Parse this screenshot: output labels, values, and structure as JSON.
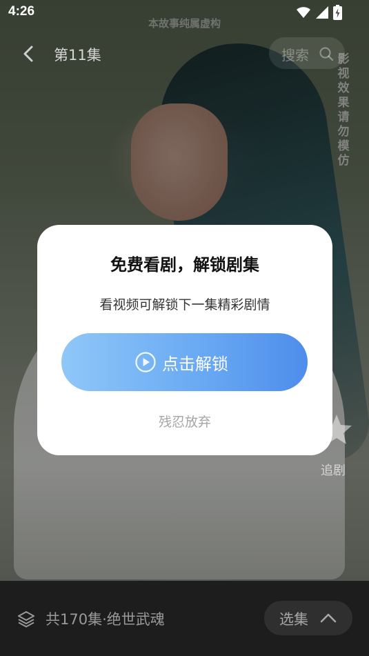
{
  "status_bar": {
    "time": "4:26",
    "icons": [
      "wifi-icon",
      "cellular-signal-icon",
      "battery-charging-icon"
    ]
  },
  "video": {
    "disclaimer": "本故事纯属虚构",
    "vertical_notice": "影视效果请勿模仿"
  },
  "top_bar": {
    "back_icon": "chevron-left-icon",
    "episode_title": "第11集",
    "search_placeholder": "搜索",
    "search_icon": "search-icon"
  },
  "side_actions": {
    "follow_label": "追剧",
    "follow_icon": "star-icon"
  },
  "bottom_bar": {
    "series_icon": "layers-icon",
    "series_info": "共170集·绝世武魂",
    "episodes_button": "选集",
    "episodes_icon": "chevron-up-icon"
  },
  "unlock_dialog": {
    "title": "免费看剧，解锁剧集",
    "subtitle": "看视频可解锁下一集精彩剧情",
    "unlock_button": "点击解锁",
    "unlock_icon": "play-circle-icon",
    "dismiss": "残忍放弃"
  },
  "colors": {
    "accent_start": "#8fc7f8",
    "accent_end": "#4e8deb",
    "bottom_bar_bg": "#1d1d1d"
  }
}
